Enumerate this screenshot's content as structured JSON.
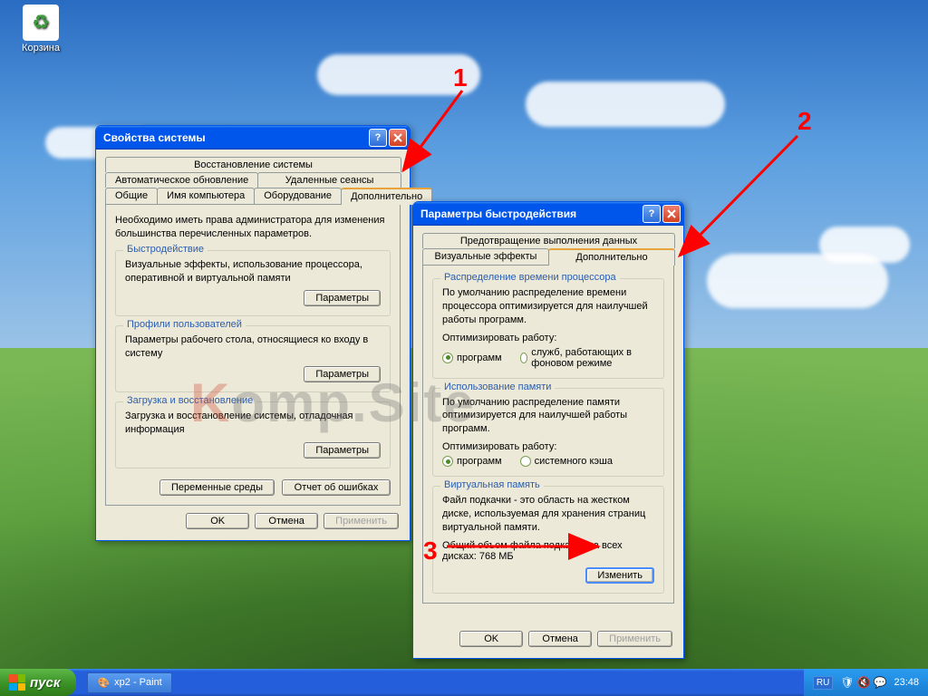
{
  "desktop": {
    "recycle_bin": "Корзина"
  },
  "win1": {
    "title": "Свойства системы",
    "tabs_row1": [
      "Восстановление системы"
    ],
    "tabs_row2": [
      "Автоматическое обновление",
      "Удаленные сеансы"
    ],
    "tabs_row3": [
      "Общие",
      "Имя компьютера",
      "Оборудование",
      "Дополнительно"
    ],
    "intro": "Необходимо иметь права администратора для изменения большинства перечисленных параметров.",
    "perf": {
      "legend": "Быстродействие",
      "desc": "Визуальные эффекты, использование процессора, оперативной и виртуальной памяти",
      "btn": "Параметры"
    },
    "profiles": {
      "legend": "Профили пользователей",
      "desc": "Параметры рабочего стола, относящиеся ко входу в систему",
      "btn": "Параметры"
    },
    "startup": {
      "legend": "Загрузка и восстановление",
      "desc": "Загрузка и восстановление системы, отладочная информация",
      "btn": "Параметры"
    },
    "env_btn": "Переменные среды",
    "err_btn": "Отчет об ошибках",
    "ok": "OK",
    "cancel": "Отмена",
    "apply": "Применить"
  },
  "win2": {
    "title": "Параметры быстродействия",
    "tabs_row1": [
      "Предотвращение выполнения данных"
    ],
    "tabs_row2": [
      "Визуальные эффекты",
      "Дополнительно"
    ],
    "cpu": {
      "legend": "Распределение времени процессора",
      "desc": "По умолчанию распределение времени процессора оптимизируется для наилучшей работы программ.",
      "label": "Оптимизировать работу:",
      "opt1": "программ",
      "opt2": "служб, работающих в фоновом режиме"
    },
    "mem": {
      "legend": "Использование памяти",
      "desc": "По умолчанию распределение памяти оптимизируется для наилучшей работы программ.",
      "label": "Оптимизировать работу:",
      "opt1": "программ",
      "opt2": "системного кэша"
    },
    "vm": {
      "legend": "Виртуальная память",
      "desc": "Файл подкачки - это область на жестком диске, используемая для хранения страниц виртуальной памяти.",
      "total": "Общий объем файла подкачки на всех дисках:  768 МБ",
      "btn": "Изменить"
    },
    "ok": "OK",
    "cancel": "Отмена",
    "apply": "Применить"
  },
  "taskbar": {
    "start": "пуск",
    "task1": "xp2 - Paint",
    "lang": "RU",
    "time": "23:48"
  },
  "anno": {
    "n1": "1",
    "n2": "2",
    "n3": "3"
  },
  "watermark_k": "K",
  "watermark_rest": "omp.Site"
}
